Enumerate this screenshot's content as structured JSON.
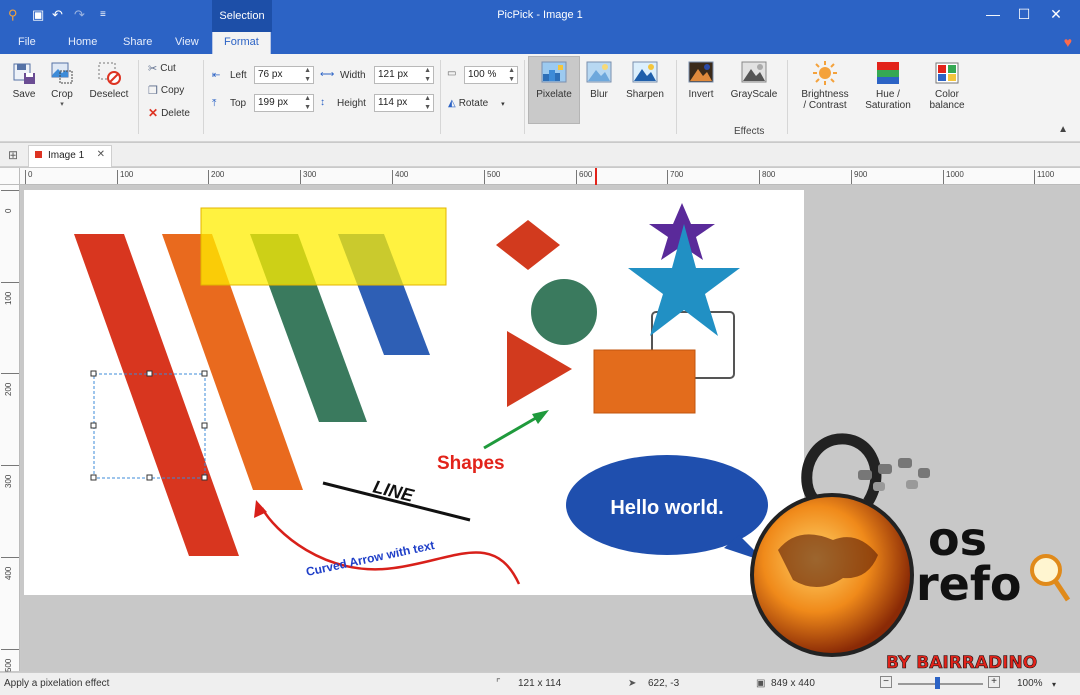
{
  "titlebar": {
    "app_title": "PicPick - Image 1",
    "context_tab": "Selection",
    "minimize": "—",
    "maximize": "☐",
    "close": "✕"
  },
  "tabs": [
    "File",
    "Home",
    "Share",
    "View",
    "Format"
  ],
  "active_tab": "Format",
  "ribbon": {
    "save": "Save",
    "crop": "Crop",
    "deselect": "Deselect",
    "cut": "Cut",
    "copy": "Copy",
    "delete": "Delete",
    "left_label": "Left",
    "left_value": "76 px",
    "top_label": "Top",
    "top_value": "199 px",
    "width_label": "Width",
    "width_value": "121 px",
    "height_label": "Height",
    "height_value": "114 px",
    "zoom_value": "100 %",
    "rotate": "Rotate",
    "effects": {
      "pixelate": "Pixelate",
      "blur": "Blur",
      "sharpen": "Sharpen",
      "invert": "Invert",
      "grayscale": "GrayScale",
      "brightness_1": "Brightness",
      "brightness_2": "/ Contrast",
      "hue_1": "Hue /",
      "hue_2": "Saturation",
      "color_1": "Color",
      "color_2": "balance"
    },
    "effects_group_label": "Effects"
  },
  "document_tab": {
    "label": "Image 1"
  },
  "ruler": {
    "h_ticks": [
      "0",
      "100",
      "200",
      "300",
      "400",
      "500",
      "600",
      "700",
      "800",
      "900",
      "1000",
      "1100"
    ],
    "v_ticks": [
      "0",
      "100",
      "200",
      "300",
      "400",
      "500"
    ]
  },
  "canvas_text": {
    "line_label": "LINE",
    "shapes_label": "Shapes",
    "curved_label": "Curved Arrow with text",
    "bubble_text": "Hello world."
  },
  "watermark": {
    "text_1": "os",
    "text_2": "refo",
    "byline": "BY BAIRRADINO"
  },
  "statusbar": {
    "hint": "Apply a pixelation effect",
    "selection_size": "121 x 114",
    "cursor_pos": "622, -3",
    "image_size": "849 x 440",
    "zoom": "100%"
  },
  "colors": {
    "titlebar": "#2c63c5",
    "accent_red": "#e2231a"
  }
}
